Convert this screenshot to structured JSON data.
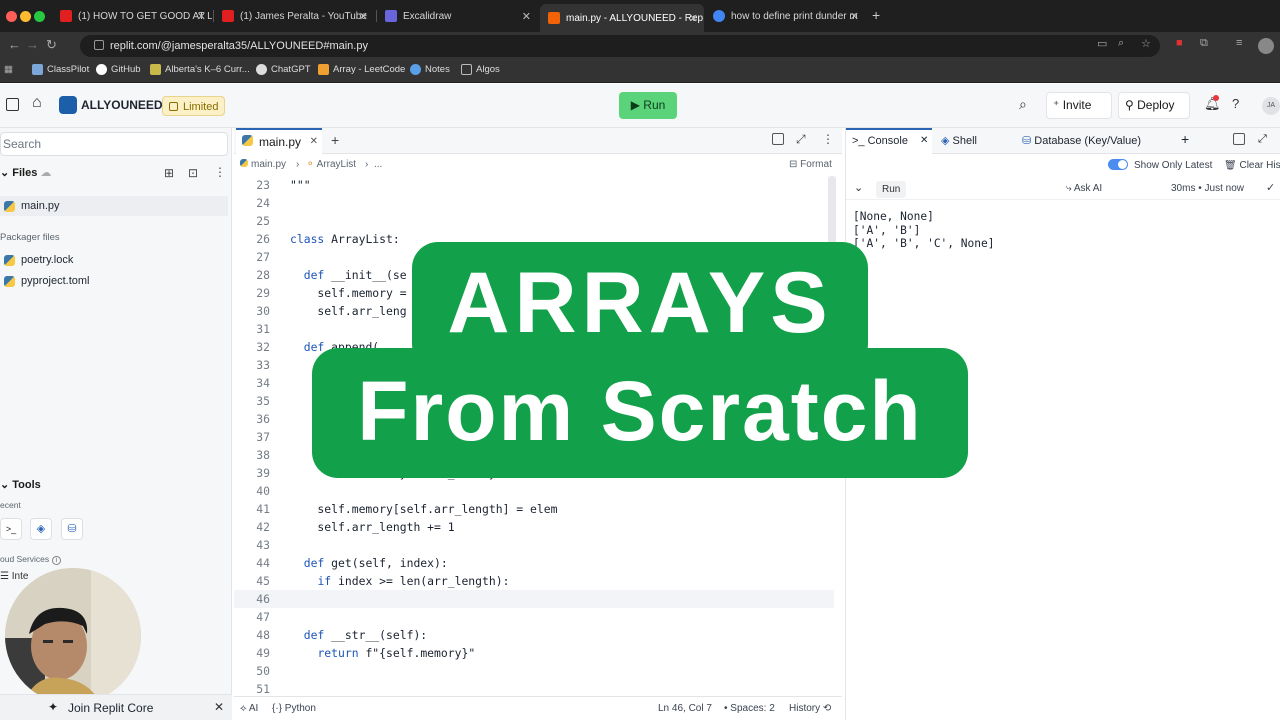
{
  "browser": {
    "tabs": [
      {
        "label": "(1) HOW TO GET GOOD AT L",
        "color": "#e02020"
      },
      {
        "label": "(1) James Peralta - YouTube",
        "color": "#e02020"
      },
      {
        "label": "Excalidraw",
        "color": "#6965db"
      },
      {
        "label": "main.py - ALLYOUNEED - Rep",
        "color": "#f26207"
      },
      {
        "label": "how to define print dunder m",
        "color": "#4285f4"
      }
    ],
    "new_tab": "+",
    "url": "replit.com/@jamesperalta35/ALLYOUNEED#main.py",
    "bookmarks": [
      "ClassPilot",
      "GitHub",
      "Alberta's K–6 Curr...",
      "ChatGPT",
      "Array - LeetCode",
      "Notes",
      "Algos"
    ]
  },
  "header": {
    "repl_name": "ALLYOUNEED",
    "badge": "Limited",
    "run_label": "Run",
    "invite_label": "Invite",
    "deploy_label": "Deploy",
    "help": "?",
    "avatar_initials": "JA"
  },
  "sidebar": {
    "search_placeholder": "Search",
    "files_title": "Files",
    "files": [
      "main.py"
    ],
    "packager_title": "Packager files",
    "packager_files": [
      "poetry.lock",
      "pyproject.toml"
    ],
    "tools_title": "Tools",
    "recent_label": "ecent",
    "cloud_label": "oud Services",
    "integrations_label": "Inte",
    "join_label": "Join Replit Core"
  },
  "editor": {
    "tab_label": "main.py",
    "breadcrumb": [
      "main.py",
      "ArrayList",
      "..."
    ],
    "format_label": "Format",
    "lines": [
      {
        "n": "23",
        "code": "\"\"\""
      },
      {
        "n": "24",
        "code": ""
      },
      {
        "n": "25",
        "code": ""
      },
      {
        "n": "26",
        "code": "class ArrayList:"
      },
      {
        "n": "27",
        "code": ""
      },
      {
        "n": "28",
        "code": "  def __init__(se"
      },
      {
        "n": "29",
        "code": "    self.memory ="
      },
      {
        "n": "30",
        "code": "    self.arr_leng"
      },
      {
        "n": "31",
        "code": ""
      },
      {
        "n": "32",
        "code": "  def append("
      },
      {
        "n": "33",
        "code": ""
      },
      {
        "n": "34",
        "code": ""
      },
      {
        "n": "35",
        "code": ""
      },
      {
        "n": "36",
        "code": ""
      },
      {
        "n": "37",
        "code": ""
      },
      {
        "n": "38",
        "code": ""
      },
      {
        "n": "39",
        "code": "      self.memory = new_memory"
      },
      {
        "n": "40",
        "code": ""
      },
      {
        "n": "41",
        "code": "    self.memory[self.arr_length] = elem"
      },
      {
        "n": "42",
        "code": "    self.arr_length += 1"
      },
      {
        "n": "43",
        "code": ""
      },
      {
        "n": "44",
        "code": "  def get(self, index):"
      },
      {
        "n": "45",
        "code": "    if index >= len(arr_length):"
      },
      {
        "n": "46",
        "code": ""
      },
      {
        "n": "47",
        "code": ""
      },
      {
        "n": "48",
        "code": "  def __str__(self):"
      },
      {
        "n": "49",
        "code": "    return f\"{self.memory}\""
      },
      {
        "n": "50",
        "code": ""
      },
      {
        "n": "51",
        "code": ""
      }
    ],
    "current_line": "46",
    "status": {
      "ai": "AI",
      "language": "Python",
      "position": "Ln 46, Col 7",
      "spaces": "Spaces: 2",
      "history": "History"
    }
  },
  "console": {
    "tabs": [
      "Console",
      "Shell",
      "Database (Key/Value)"
    ],
    "show_only_latest": "Show Only Latest",
    "clear_history": "Clear Hist",
    "run_label": "Run",
    "ask_ai": "Ask AI",
    "timing": "30ms • Just now",
    "output": [
      "[None, None]",
      "['A', 'B']",
      "['A', 'B', 'C', None]"
    ]
  },
  "overlay": {
    "line1": "ARRAYS",
    "line2": "From Scratch"
  },
  "colors": {
    "overlay_green": "#12a14a",
    "run_green": "#5bd37a",
    "keyword_blue": "#1d55b8"
  }
}
